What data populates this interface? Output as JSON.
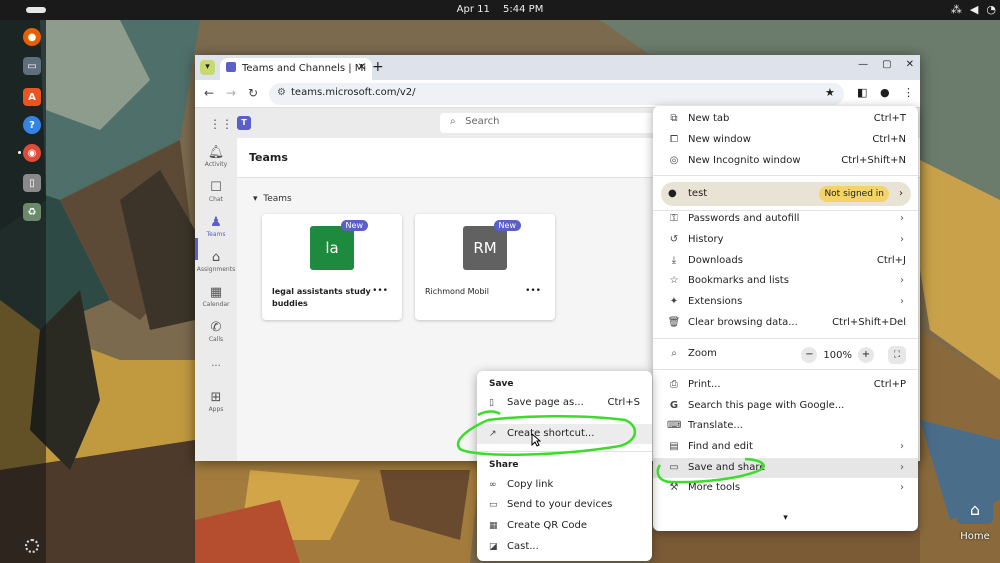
{
  "topbar": {
    "date": "Apr 11",
    "time": "5:44 PM",
    "tray_icons": [
      "network-icon",
      "volume-icon",
      "power-icon"
    ]
  },
  "dock": {
    "items": [
      "firefox-icon",
      "files-icon",
      "software-center-icon",
      "help-icon",
      "chrome-icon",
      "disk-icon",
      "trash-icon"
    ]
  },
  "desktop": {
    "home_label": "Home"
  },
  "browser": {
    "tab_title": "Teams and Channels | Mi",
    "url": "teams.microsoft.com/v2/"
  },
  "teams": {
    "search_placeholder": "Search",
    "page_title": "Teams",
    "section_label": "Teams",
    "rail": [
      {
        "label": "Activity",
        "icon": "bell-icon"
      },
      {
        "label": "Chat",
        "icon": "chat-icon"
      },
      {
        "label": "Teams",
        "icon": "teams-icon"
      },
      {
        "label": "Assignments",
        "icon": "assignments-icon"
      },
      {
        "label": "Calendar",
        "icon": "calendar-icon"
      },
      {
        "label": "Calls",
        "icon": "phone-icon"
      },
      {
        "label": "...",
        "icon": "more-icon"
      },
      {
        "label": "Apps",
        "icon": "apps-icon"
      }
    ],
    "cards": [
      {
        "initials": "la",
        "name": "legal assistants study buddies",
        "badge": "New",
        "color": "#1e8a3e"
      },
      {
        "initials": "RM",
        "name": "Richmond Mobil",
        "badge": "New",
        "color": "#616161"
      }
    ]
  },
  "chrome_menu": {
    "new_tab": {
      "label": "New tab",
      "shortcut": "Ctrl+T"
    },
    "new_window": {
      "label": "New window",
      "shortcut": "Ctrl+N"
    },
    "new_incognito": {
      "label": "New Incognito window",
      "shortcut": "Ctrl+Shift+N"
    },
    "profile": {
      "name": "test",
      "status": "Not signed in"
    },
    "passwords": {
      "label": "Passwords and autofill"
    },
    "history": {
      "label": "History"
    },
    "downloads": {
      "label": "Downloads",
      "shortcut": "Ctrl+J"
    },
    "bookmarks": {
      "label": "Bookmarks and lists"
    },
    "extensions": {
      "label": "Extensions"
    },
    "clear_data": {
      "label": "Clear browsing data...",
      "shortcut": "Ctrl+Shift+Del"
    },
    "zoom": {
      "label": "Zoom",
      "minus": "−",
      "value": "100%",
      "plus": "+"
    },
    "print": {
      "label": "Print...",
      "shortcut": "Ctrl+P"
    },
    "search_google": {
      "label": "Search this page with Google..."
    },
    "translate": {
      "label": "Translate..."
    },
    "find_edit": {
      "label": "Find and edit"
    },
    "save_share": {
      "label": "Save and share"
    },
    "more_tools": {
      "label": "More tools"
    },
    "footer": "▾"
  },
  "save_submenu": {
    "save_heading": "Save",
    "save_page": {
      "label": "Save page as...",
      "shortcut": "Ctrl+S"
    },
    "create_shortcut": {
      "label": "Create shortcut..."
    },
    "share_heading": "Share",
    "copy_link": {
      "label": "Copy link"
    },
    "send_devices": {
      "label": "Send to your devices"
    },
    "qr_code": {
      "label": "Create QR Code"
    },
    "cast": {
      "label": "Cast..."
    }
  },
  "colors": {
    "teams_accent": "#5b5fc7",
    "annotation": "#3ddc2a",
    "profile_badge": "#f3d36a"
  }
}
